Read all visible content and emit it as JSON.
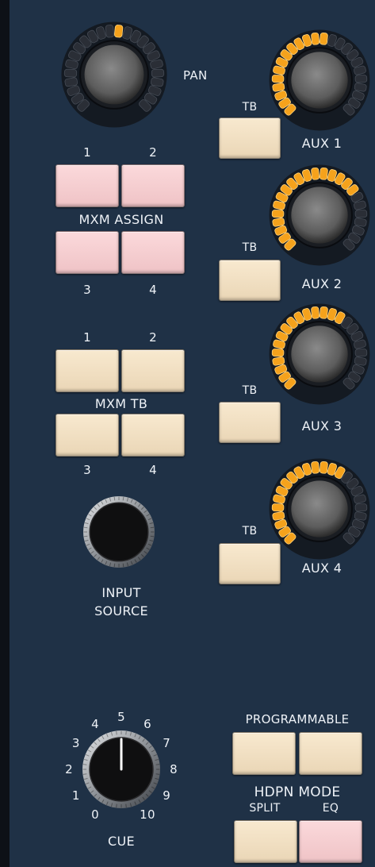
{
  "pan": {
    "label": "PAN"
  },
  "aux": [
    {
      "tb_label": "TB",
      "label": "AUX 1",
      "level": 0.55
    },
    {
      "tb_label": "TB",
      "label": "AUX 2",
      "level": 0.72
    },
    {
      "tb_label": "TB",
      "label": "AUX 3",
      "level": 0.62
    },
    {
      "tb_label": "TB",
      "label": "AUX 4",
      "level": 0.62
    }
  ],
  "mxm_assign": {
    "label": "MXM ASSIGN",
    "buttons": [
      "1",
      "2",
      "3",
      "4"
    ]
  },
  "mxm_tb": {
    "label": "MXM TB",
    "buttons": [
      "1",
      "2",
      "3",
      "4"
    ]
  },
  "input_source": {
    "line1": "INPUT",
    "line2": "SOURCE"
  },
  "cue": {
    "label": "CUE",
    "scale": [
      "0",
      "1",
      "2",
      "3",
      "4",
      "5",
      "6",
      "7",
      "8",
      "9",
      "10"
    ],
    "value": 5
  },
  "programmable": {
    "label": "PROGRAMMABLE"
  },
  "hdpn_mode": {
    "label": "HDPN MODE",
    "split_label": "SPLIT",
    "eq_label": "EQ"
  },
  "colors": {
    "panel": "#1f3146",
    "led_on": "#f5a21c",
    "button_cream": "#f3e2c4",
    "button_pink": "#f7d1d4"
  }
}
